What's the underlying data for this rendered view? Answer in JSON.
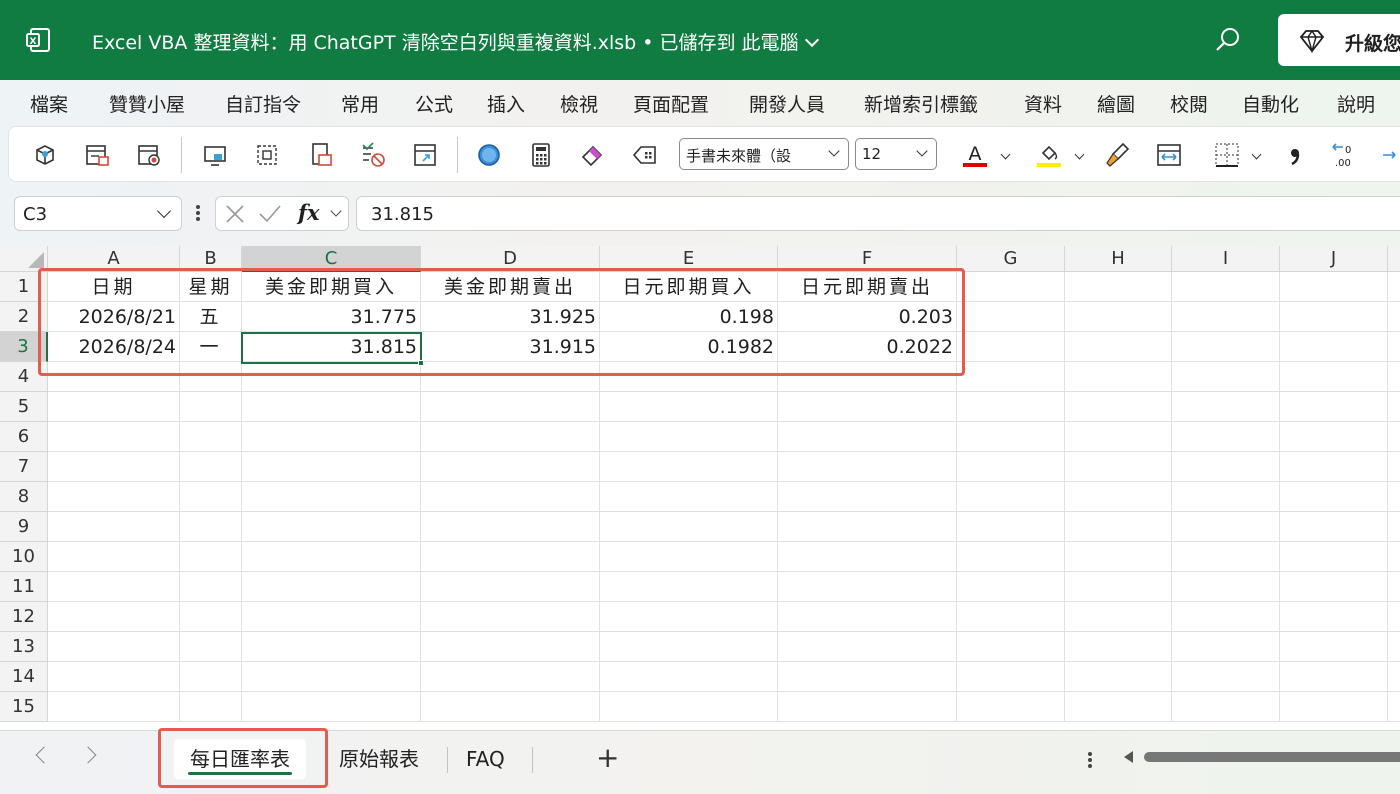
{
  "titlebar": {
    "title": "Excel VBA 整理資料：用 ChatGPT 清除空白列與重複資料.xlsb • 已儲存到 此電腦",
    "upgrade_label": "升級您",
    "bg_color": "#107c41"
  },
  "menu": {
    "tabs": [
      "檔案",
      "贊贊小屋",
      "自訂指令",
      "常用",
      "公式",
      "插入",
      "檢視",
      "頁面配置",
      "開發人員",
      "新增索引標籤",
      "資料",
      "繪圖",
      "校閱",
      "自動化",
      "說明"
    ]
  },
  "toolbar": {
    "font_name": "手書未來體（設",
    "font_size": "12",
    "font_color": "#e00000",
    "highlight_color": "#ffff00",
    "icons": [
      "3d-object-icon",
      "print-form-icon",
      "record-macro-icon",
      "screen-capture-icon",
      "select-area-icon",
      "page-setup-icon",
      "clear-check-icon",
      "insert-table-icon",
      "circle-shape-icon",
      "calculator-icon",
      "eraser-icon",
      "clear-format-icon",
      "format-painter-icon",
      "fit-width-icon",
      "borders-icon",
      "comma-style-icon",
      "decrease-decimal-icon"
    ]
  },
  "formula_bar": {
    "name_box": "C3",
    "fx_label": "fx",
    "formula": "31.815"
  },
  "grid": {
    "columns": [
      "A",
      "B",
      "C",
      "D",
      "E",
      "F",
      "G",
      "H",
      "I",
      "J"
    ],
    "rows": [
      "1",
      "2",
      "3",
      "4",
      "5",
      "6",
      "7",
      "8",
      "9",
      "10",
      "11",
      "12",
      "13",
      "14",
      "15"
    ],
    "header": [
      "日期",
      "星期",
      "美金即期買入",
      "美金即期賣出",
      "日元即期買入",
      "日元即期賣出"
    ],
    "data": [
      [
        "2026/8/21",
        "五",
        "31.775",
        "31.925",
        "0.198",
        "0.203"
      ],
      [
        "2026/8/24",
        "一",
        "31.815",
        "31.915",
        "0.1982",
        "0.2022"
      ]
    ],
    "selected_cell": "C3",
    "accent_color": "#1e7145",
    "annotation_color": "#e25d4d"
  },
  "sheets": {
    "tabs": [
      "每日匯率表",
      "原始報表",
      "FAQ"
    ],
    "active": "每日匯率表",
    "add_label": "+"
  }
}
